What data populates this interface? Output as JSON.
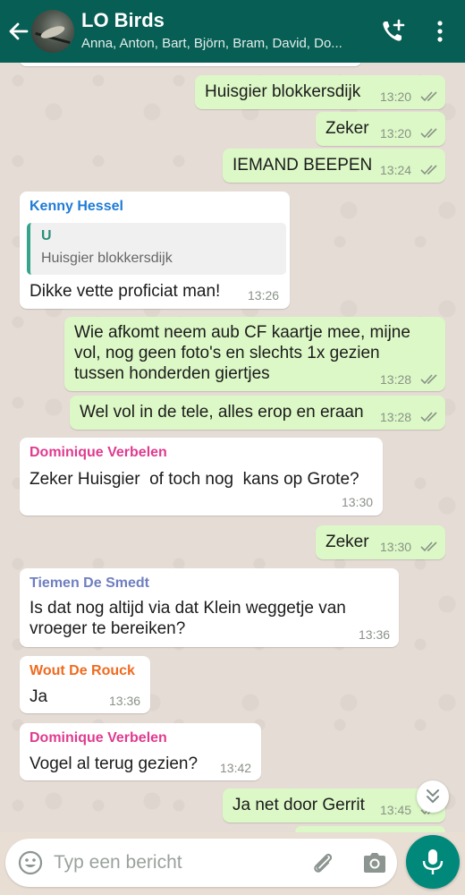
{
  "header": {
    "back_icon": "arrow-left-icon",
    "title": "LO Birds",
    "subtitle": "Anna, Anton, Bart, Björn, Bram, David, Do...",
    "call_icon": "add-call-icon",
    "more_icon": "more-vert-icon"
  },
  "messages": [
    {
      "type": "out",
      "text": "Huisgier blokkersdijk",
      "time": "13:20",
      "status": "read"
    },
    {
      "type": "out",
      "text": "Zeker",
      "time": "13:20",
      "status": "read"
    },
    {
      "type": "out",
      "text": "IEMAND BEEPEN",
      "time": "13:24",
      "status": "read"
    },
    {
      "type": "in",
      "sender": "Kenny Hessel",
      "sender_color": "#1f7bd6",
      "quote": {
        "name": "U",
        "text": "Huisgier blokkersdijk"
      },
      "text": "Dikke vette proficiat man!",
      "time": "13:26"
    },
    {
      "type": "out",
      "text_lines": [
        "Wie afkomt neem aub CF kaartje mee, mijne",
        "vol, nog geen foto's en slechts 1x gezien",
        "tussen honderden giertjes"
      ],
      "time": "13:28",
      "status": "read"
    },
    {
      "type": "out",
      "text": "Wel vol in de tele, alles erop en eraan",
      "time": "13:28",
      "status": "read"
    },
    {
      "type": "in",
      "sender": "Dominique Verbelen",
      "sender_color": "#e03a8f",
      "text": "Zeker Huisgier  of toch nog  kans op Grote?",
      "time": "13:30"
    },
    {
      "type": "out",
      "text": "Zeker",
      "time": "13:30",
      "status": "read"
    },
    {
      "type": "in",
      "sender": "Tiemen De Smedt",
      "sender_color": "#6f7fc0",
      "text_lines": [
        "Is dat nog altijd via dat Klein weggetje van",
        "vroeger te bereiken?"
      ],
      "time": "13:36"
    },
    {
      "type": "in",
      "sender": "Wout De Rouck",
      "sender_color": "#f06a1f",
      "text": "Ja",
      "time": "13:36"
    },
    {
      "type": "in",
      "sender": "Dominique Verbelen",
      "sender_color": "#e03a8f",
      "text": "Vogel al terug gezien?",
      "time": "13:42"
    },
    {
      "type": "out",
      "text": "Ja net door Gerrit",
      "time": "13:45",
      "status": "read"
    }
  ],
  "scroll_down_icon": "double-chevron-down-icon",
  "input": {
    "placeholder": "Typ een bericht",
    "emoji_icon": "emoji-icon",
    "attach_icon": "paperclip-icon",
    "camera_icon": "camera-icon",
    "mic_icon": "microphone-icon"
  },
  "colors": {
    "header": "#075e54",
    "outgoing_bubble": "#dcf8c6",
    "incoming_bubble": "#ffffff",
    "mic_button": "#00897b",
    "read_ticks": "#8a9288"
  }
}
